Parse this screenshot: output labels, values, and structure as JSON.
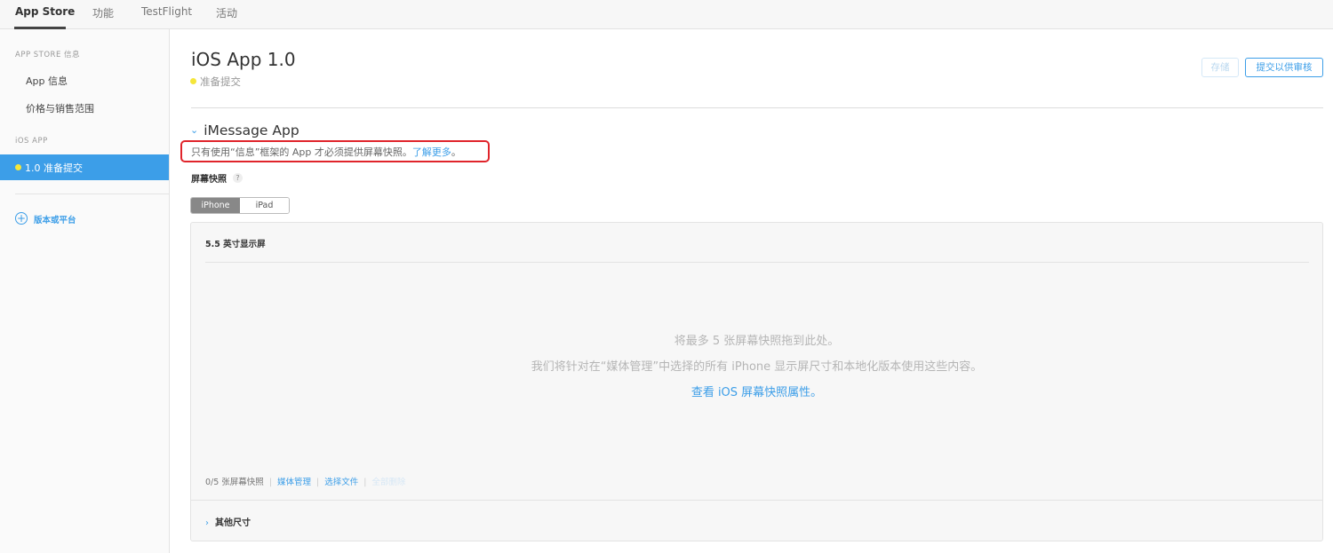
{
  "topnav": {
    "tabs": [
      {
        "label": "App Store",
        "active": true
      },
      {
        "label": "功能",
        "active": false
      },
      {
        "label": "TestFlight",
        "active": false
      },
      {
        "label": "活动",
        "active": false
      }
    ]
  },
  "sidebar": {
    "section_store": "APP STORE 信息",
    "item_app_info": "App 信息",
    "item_pricing": "价格与销售范围",
    "section_ios": "iOS APP",
    "active_version": "1.0 准备提交",
    "add_label": "版本或平台"
  },
  "main": {
    "title": "iOS App 1.0",
    "status": "准备提交",
    "save_label": "存储",
    "submit_label": "提交以供审核",
    "section_title": "iMessage App",
    "notice_text": "只有使用“信息”框架的 App 才必须提供屏幕快照。",
    "notice_link": "了解更多",
    "notice_end": "。",
    "screenshots_label": "屏幕快照",
    "help_symbol": "?",
    "device_tabs": [
      "iPhone",
      "iPad"
    ],
    "panel_title": "5.5 英寸显示屏",
    "drop_line1": "将最多 5 张屏幕快照拖到此处。",
    "drop_line2": "我们将针对在“媒体管理”中选择的所有 iPhone 显示屏尺寸和本地化版本使用这些内容。",
    "drop_line3": "查看 iOS 屏幕快照属性。",
    "footer_count": "0/5 张屏幕快照",
    "footer_media": "媒体管理",
    "footer_choose": "选择文件",
    "footer_delete": "全部删除",
    "other_sizes": "其他尺寸"
  },
  "colors": {
    "accent": "#3c9ee8",
    "status_dot": "#f5e63a",
    "highlight_border": "#e0242b"
  }
}
